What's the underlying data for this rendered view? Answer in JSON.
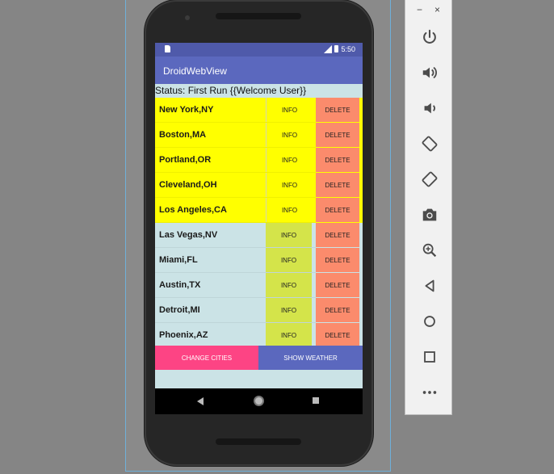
{
  "device": {
    "status_bar": {
      "time": "5:50"
    },
    "app_title": "DroidWebView",
    "status_text": "Status: First Run {{Welcome User}}",
    "cities": [
      {
        "name": "New York,NY",
        "info": "INFO",
        "delete": "DELETE",
        "highlighted": true
      },
      {
        "name": "Boston,MA",
        "info": "INFO",
        "delete": "DELETE",
        "highlighted": true
      },
      {
        "name": "Portland,OR",
        "info": "INFO",
        "delete": "DELETE",
        "highlighted": true
      },
      {
        "name": "Cleveland,OH",
        "info": "INFO",
        "delete": "DELETE",
        "highlighted": true
      },
      {
        "name": "Los Angeles,CA",
        "info": "INFO",
        "delete": "DELETE",
        "highlighted": true
      },
      {
        "name": "Las Vegas,NV",
        "info": "INFO",
        "delete": "DELETE",
        "highlighted": false
      },
      {
        "name": "Miami,FL",
        "info": "INFO",
        "delete": "DELETE",
        "highlighted": false
      },
      {
        "name": "Austin,TX",
        "info": "INFO",
        "delete": "DELETE",
        "highlighted": false
      },
      {
        "name": "Detroit,MI",
        "info": "INFO",
        "delete": "DELETE",
        "highlighted": false
      },
      {
        "name": "Phoenix,AZ",
        "info": "INFO",
        "delete": "DELETE",
        "highlighted": false
      }
    ],
    "buttons": {
      "change_cities": "CHANGE CITIES",
      "show_weather": "SHOW WEATHER"
    }
  },
  "toolbar": {
    "minimize": "−",
    "close": "×",
    "items": [
      "power-icon",
      "volume-up-icon",
      "volume-down-icon",
      "rotate-left-icon",
      "rotate-right-icon",
      "camera-icon",
      "zoom-icon",
      "back-icon",
      "home-icon",
      "overview-icon",
      "more-icon"
    ]
  },
  "colors": {
    "app_bar": "#5b68be",
    "status_bar": "#4f5aaa",
    "highlight_row": "#ffff00",
    "info_button_light": "#d4e44a",
    "delete_button": "#fb8b6c",
    "change_cities_button": "#fd4484",
    "screen_background": "#cbe3e6"
  }
}
